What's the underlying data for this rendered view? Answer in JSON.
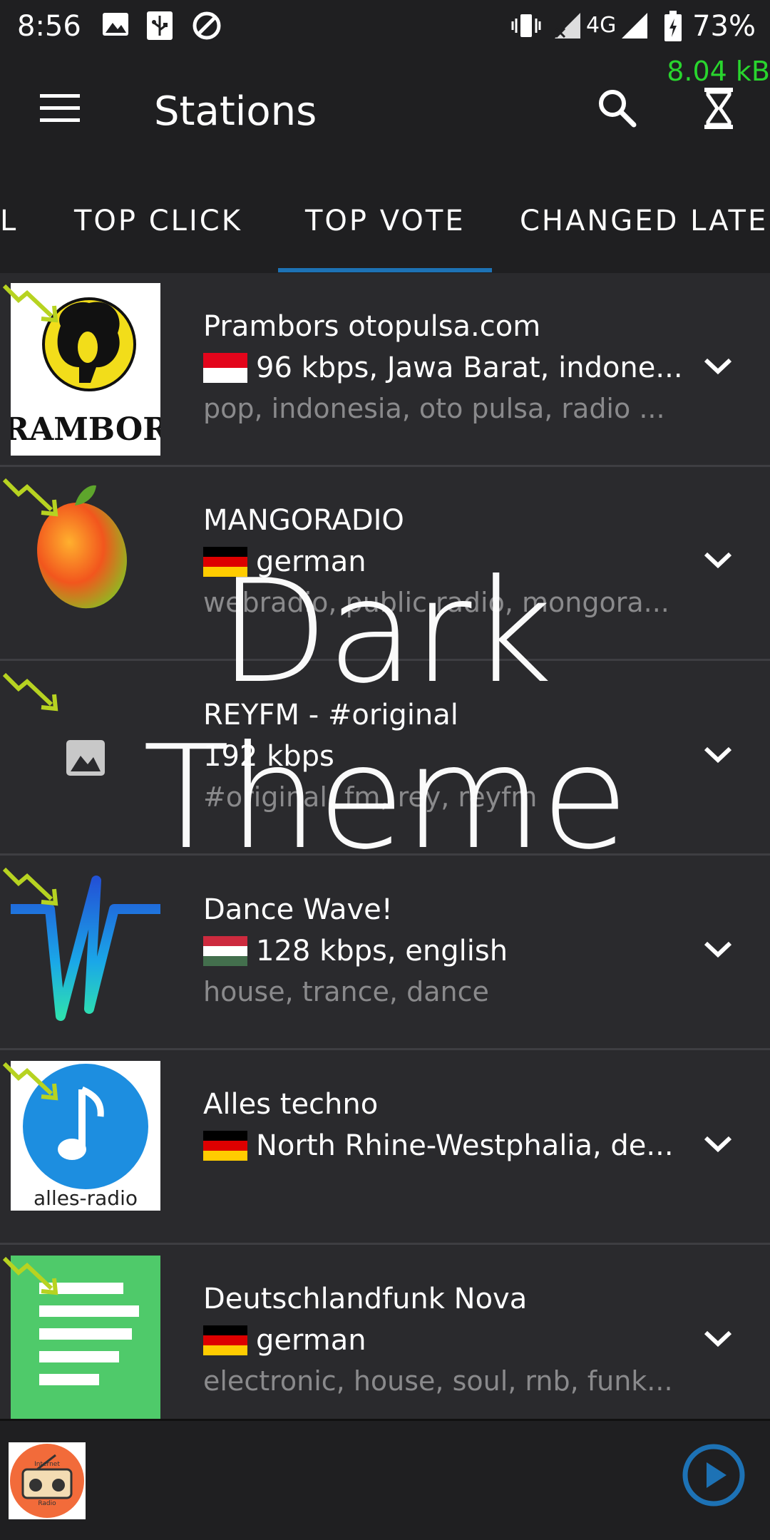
{
  "status_bar": {
    "time": "8:56",
    "network": "4G",
    "battery": "73%",
    "speed": "8.04 kB"
  },
  "app_bar": {
    "title": "Stations",
    "menu_icon": "hamburger-menu-icon",
    "search_icon": "search-icon",
    "timer_icon": "hourglass-icon"
  },
  "tabs": [
    {
      "label": "L"
    },
    {
      "label": "TOP CLICK"
    },
    {
      "label": "TOP VOTE",
      "selected": true
    },
    {
      "label": "CHANGED LATE"
    }
  ],
  "stations": [
    {
      "name": "Prambors otopulsa.com",
      "meta": "96 kbps, Jawa Barat, indone...",
      "tags": "pop, indonesia, oto pulsa, radio ...",
      "flag": "id",
      "logo_text": "PRAMBORS"
    },
    {
      "name": "MANGORADIO",
      "meta": "german",
      "tags": "webradio, public radio, mongora...",
      "flag": "de",
      "logo_text": ""
    },
    {
      "name": "REYFM - #original",
      "meta": "192 kbps",
      "tags": "#original, fm, rey, reyfm",
      "flag": "",
      "logo_text": ""
    },
    {
      "name": "Dance Wave!",
      "meta": "128 kbps, english",
      "tags": "house, trance, dance",
      "flag": "hu",
      "logo_text": ""
    },
    {
      "name": "Alles techno",
      "meta": "North Rhine-Westphalia, de...",
      "tags": "",
      "flag": "de",
      "logo_text": "alles-radio"
    },
    {
      "name": "Deutschlandfunk Nova",
      "meta": "german",
      "tags": "electronic, house, soul, rnb, funk...",
      "flag": "de",
      "logo_text": ""
    }
  ],
  "watermark": "Dark Theme",
  "player": {
    "icon_text_top": "Internet",
    "icon_text_bottom": "Radio"
  },
  "colors": {
    "background": "#2a2a2d",
    "bar": "#1f1f21",
    "accent": "#1d72b5",
    "speed_green": "#29d52e",
    "secondary_text": "#8a8a8c"
  }
}
